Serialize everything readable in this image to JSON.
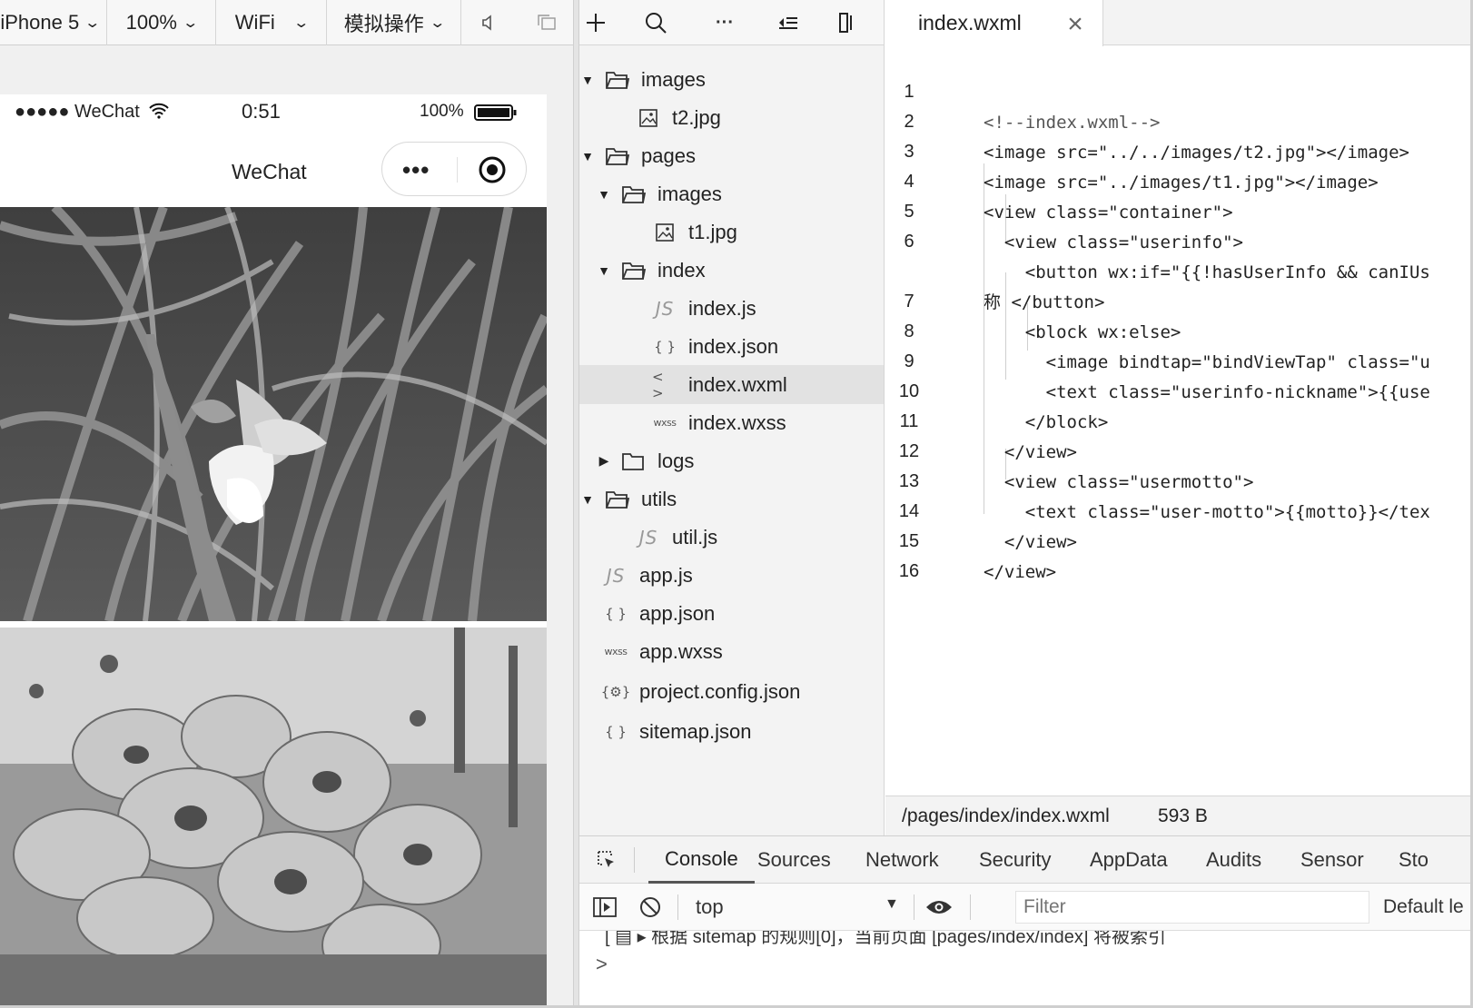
{
  "simulator": {
    "toolbar": {
      "device": "iPhone 5",
      "zoom": "100%",
      "network": "WiFi",
      "simulate": "模拟操作"
    },
    "status_bar": {
      "carrier": "●●●●● WeChat",
      "time": "0:51",
      "battery": "100%"
    },
    "nav_title": "WeChat",
    "capsule_dots": "•••"
  },
  "file_tree": {
    "rows": [
      {
        "label": "images",
        "icon": "folder-icon"
      },
      {
        "label": "t2.jpg",
        "icon": "image-file-icon"
      },
      {
        "label": "pages",
        "icon": "folder-icon"
      },
      {
        "label": "images",
        "icon": "folder-icon"
      },
      {
        "label": "t1.jpg",
        "icon": "image-file-icon"
      },
      {
        "label": "index",
        "icon": "folder-icon"
      },
      {
        "label": "index.js",
        "icon": "js-file-icon",
        "icon_text": "JS"
      },
      {
        "label": "index.json",
        "icon": "json-file-icon",
        "icon_text": "{ }"
      },
      {
        "label": "index.wxml",
        "icon": "wxml-file-icon",
        "icon_text": "< >"
      },
      {
        "label": "index.wxss",
        "icon": "wxss-file-icon",
        "icon_text": "wxss"
      },
      {
        "label": "logs",
        "icon": "folder-icon"
      },
      {
        "label": "utils",
        "icon": "folder-icon"
      },
      {
        "label": "util.js",
        "icon": "js-file-icon",
        "icon_text": "JS"
      },
      {
        "label": "app.js",
        "icon": "js-file-icon",
        "icon_text": "JS"
      },
      {
        "label": "app.json",
        "icon": "json-file-icon",
        "icon_text": "{ }"
      },
      {
        "label": "app.wxss",
        "icon": "wxss-file-icon",
        "icon_text": "wxss"
      },
      {
        "label": "project.config.json",
        "icon": "config-file-icon",
        "icon_text": "{⚙}"
      },
      {
        "label": "sitemap.json",
        "icon": "json-file-icon",
        "icon_text": "{ }"
      }
    ]
  },
  "editor": {
    "tab_label": "index.wxml",
    "lines": [
      {
        "n": "1",
        "text": "<!--index.wxml-->"
      },
      {
        "n": "2",
        "text": "<image src=\"../../images/t2.jpg\"></image>"
      },
      {
        "n": "3",
        "text": "<image src=\"../images/t1.jpg\"></image>"
      },
      {
        "n": "4",
        "text": "<view class=\"container\">"
      },
      {
        "n": "5",
        "text": "  <view class=\"userinfo\">"
      },
      {
        "n": "6",
        "text": "    <button wx:if=\"{{!hasUserInfo && canIUs"
      },
      {
        "n": "",
        "text": "称 </button>"
      },
      {
        "n": "7",
        "text": "    <block wx:else>"
      },
      {
        "n": "8",
        "text": "      <image bindtap=\"bindViewTap\" class=\"u"
      },
      {
        "n": "9",
        "text": "      <text class=\"userinfo-nickname\">{{use"
      },
      {
        "n": "10",
        "text": "    </block>"
      },
      {
        "n": "11",
        "text": "  </view>"
      },
      {
        "n": "12",
        "text": "  <view class=\"usermotto\">"
      },
      {
        "n": "13",
        "text": "    <text class=\"user-motto\">{{motto}}</tex"
      },
      {
        "n": "14",
        "text": "  </view>"
      },
      {
        "n": "15",
        "text": "</view>"
      },
      {
        "n": "16",
        "text": ""
      }
    ],
    "status": {
      "path": "/pages/index/index.wxml",
      "size": "593 B"
    }
  },
  "devtools": {
    "tabs": [
      "Console",
      "Sources",
      "Network",
      "Security",
      "AppData",
      "Audits",
      "Sensor",
      "Sto"
    ],
    "context": "top",
    "filter_placeholder": "Filter",
    "levels": "Default le",
    "log_text": "[ ▤ ▸ 根据 sitemap 的规则[0]，当前页面 [pages/index/index] 将被索引",
    "prompt": ">"
  }
}
